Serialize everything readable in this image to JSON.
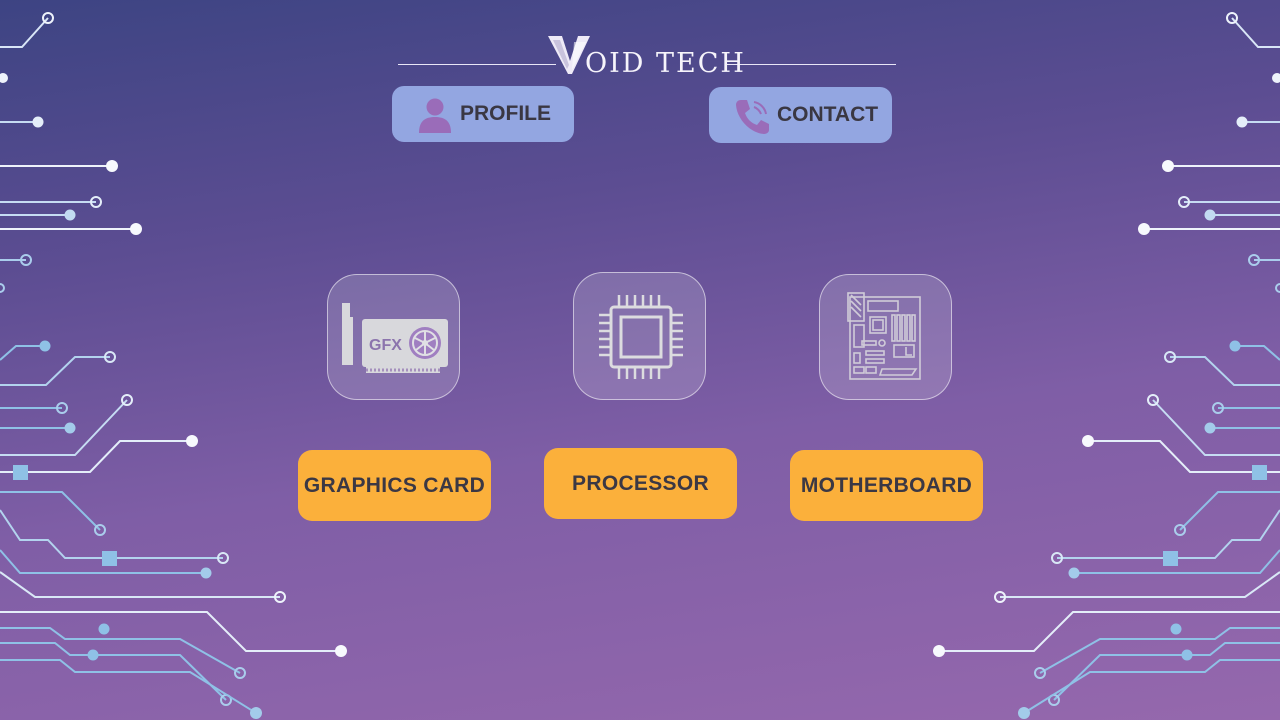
{
  "brand": {
    "name": "OID TECH",
    "logo_letter": "V"
  },
  "nav": {
    "profile_label": "PROFILE",
    "contact_label": "CONTACT"
  },
  "icons": {
    "gpu_text": "GFX"
  },
  "categories": [
    {
      "label": "GRAPHICS CARD",
      "icon": "graphics-card-icon"
    },
    {
      "label": "PROCESSOR",
      "icon": "cpu-chip-icon"
    },
    {
      "label": "MOTHERBOARD",
      "icon": "motherboard-icon"
    }
  ],
  "colors": {
    "nav_button": "#93a6e1",
    "category_button": "#fbb03b",
    "icon_purple": "#9a6cb9",
    "background_top": "#3d4483",
    "background_bottom": "#9568ad"
  }
}
